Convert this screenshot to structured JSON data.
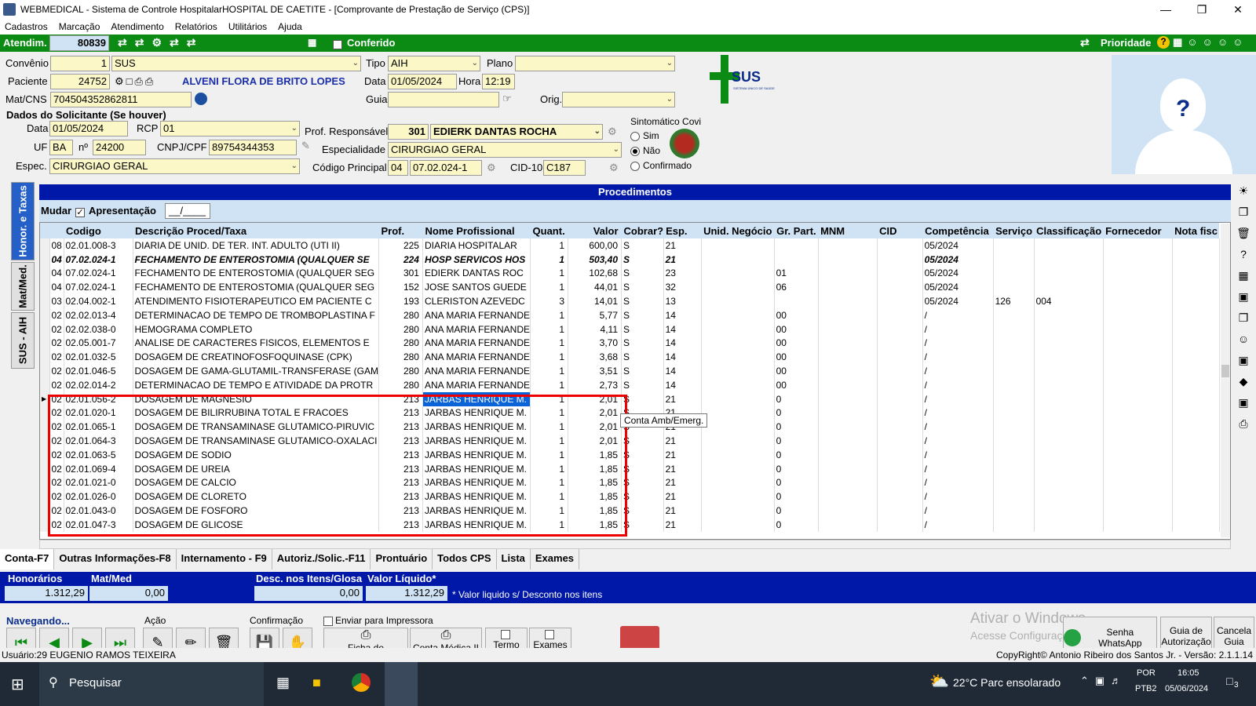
{
  "window": {
    "title": "WEBMEDICAL - Sistema de Controle HospitalarHOSPITAL DE CAETITE - [Comprovante de Prestação de Serviço  (CPS)]"
  },
  "menu": [
    "Cadastros",
    "Marcação",
    "Atendimento",
    "Relatórios",
    "Utilitários",
    "Ajuda"
  ],
  "topbar": {
    "atendim_label": "Atendim.",
    "atendim_value": "80839",
    "conferido": "Conferido",
    "prioridade": "Prioridade"
  },
  "header": {
    "convenio_label": "Convênio",
    "convenio_code": "1",
    "convenio_name": "SUS",
    "tipo_label": "Tipo",
    "tipo_value": "AIH",
    "plano_label": "Plano",
    "plano_value": "",
    "paciente_label": "Paciente",
    "paciente_code": "24752",
    "paciente_name": "ALVENI FLORA DE BRITO LOPES",
    "data_label": "Data",
    "data_value": "01/05/2024",
    "hora_label": "Hora",
    "hora_value": "12:19",
    "matcns_label": "Mat/CNS",
    "matcns_value": "704504352862811",
    "guia_label": "Guia",
    "guia_value": "",
    "orig_label": "Orig.",
    "orig_value": ""
  },
  "solicitante": {
    "title": "Dados do Solicitante (Se houver)",
    "data_label": "Data",
    "data_value": "01/05/2024",
    "rcp_label": "RCP",
    "rcp_value": "01",
    "uf_label": "UF",
    "uf_value": "BA",
    "n_label": "nº",
    "n_value": "24200",
    "cnpj_label": "CNPJ/CPF",
    "cnpj_value": "89754344353",
    "espec_label": "Espec.",
    "espec_value": "CIRURGIAO GERAL"
  },
  "prof": {
    "resp_label": "Prof. Responsável",
    "resp_code": "301",
    "resp_name": "EDIERK DANTAS ROCHA",
    "espec_label": "Especialidade",
    "espec_value": "CIRURGIAO GERAL",
    "cod_label": "Código Principal",
    "cod_a": "04",
    "cod_b": "07.02.024-1",
    "cid_label": "CID-10",
    "cid_value": "C187"
  },
  "covid": {
    "title": "Sintomático Covi",
    "options": [
      "Sim",
      "Não",
      "Confirmado"
    ],
    "selected": 1
  },
  "sus_logo": {
    "text": "SUS",
    "sub": "SISTEMA ÚNICO DE SAÚDE"
  },
  "side_tabs": [
    "Honor. e Taxas",
    "Mat/Med.",
    "SUS - AIH"
  ],
  "procedures": {
    "title": "Procedimentos",
    "mudar": "Mudar",
    "apresentacao": "Apresentação",
    "apres_value": "__/____",
    "columns": [
      "Codigo",
      "Descrição Proced/Taxa",
      "Prof.",
      "Nome Profissional",
      "Quant.",
      "Valor",
      "Cobrar?",
      "Esp.",
      "Unid. Negócio",
      "Gr. Part.",
      "MNM",
      "CID",
      "Competência",
      "Serviço",
      "Classificação",
      "Fornecedor",
      "Nota fisc"
    ],
    "rows": [
      [
        "08",
        "02.01.008-3",
        "DIARIA DE UNID. DE TER. INT. ADULTO (UTI II)",
        "225",
        "DIARIA HOSPITALAR",
        "1",
        "600,00",
        "S",
        "21",
        "",
        "",
        "",
        "",
        "05/2024",
        "",
        "",
        "",
        ""
      ],
      [
        "04",
        "07.02.024-1",
        "FECHAMENTO DE ENTEROSTOMIA (QUALQUER SE",
        "224",
        "HOSP SERVICOS HOS",
        "1",
        "503,40",
        "S",
        "21",
        "",
        "",
        "",
        "",
        "05/2024",
        "",
        "",
        "",
        ""
      ],
      [
        "04",
        "07.02.024-1",
        "FECHAMENTO DE ENTEROSTOMIA (QUALQUER SEG",
        "301",
        "EDIERK DANTAS ROC",
        "1",
        "102,68",
        "S",
        "23",
        "",
        "01",
        "",
        "",
        "05/2024",
        "",
        "",
        "",
        ""
      ],
      [
        "04",
        "07.02.024-1",
        "FECHAMENTO DE ENTEROSTOMIA (QUALQUER SEG",
        "152",
        "JOSE SANTOS GUEDE",
        "1",
        "44,01",
        "S",
        "32",
        "",
        "06",
        "",
        "",
        "05/2024",
        "",
        "",
        "",
        ""
      ],
      [
        "03",
        "02.04.002-1",
        "ATENDIMENTO FISIOTERAPEUTICO EM PACIENTE C",
        "193",
        "CLERISTON AZEVEDC",
        "3",
        "14,01",
        "S",
        "13",
        "",
        "",
        "",
        "",
        "05/2024",
        "126",
        "004",
        "",
        ""
      ],
      [
        "02",
        "02.02.013-4",
        "DETERMINACAO DE TEMPO DE TROMBOPLASTINA F",
        "280",
        "ANA MARIA FERNANDE",
        "1",
        "5,77",
        "S",
        "14",
        "",
        "00",
        "",
        "",
        "/",
        "",
        "",
        "",
        ""
      ],
      [
        "02",
        "02.02.038-0",
        "HEMOGRAMA COMPLETO",
        "280",
        "ANA MARIA FERNANDE",
        "1",
        "4,11",
        "S",
        "14",
        "",
        "00",
        "",
        "",
        "/",
        "",
        "",
        "",
        ""
      ],
      [
        "02",
        "02.05.001-7",
        "ANALISE DE CARACTERES FISICOS, ELEMENTOS E",
        "280",
        "ANA MARIA FERNANDE",
        "1",
        "3,70",
        "S",
        "14",
        "",
        "00",
        "",
        "",
        "/",
        "",
        "",
        "",
        ""
      ],
      [
        "02",
        "02.01.032-5",
        "DOSAGEM DE CREATINOFOSFOQUINASE (CPK)",
        "280",
        "ANA MARIA FERNANDE",
        "1",
        "3,68",
        "S",
        "14",
        "",
        "00",
        "",
        "",
        "/",
        "",
        "",
        "",
        ""
      ],
      [
        "02",
        "02.01.046-5",
        "DOSAGEM DE GAMA-GLUTAMIL-TRANSFERASE (GAM",
        "280",
        "ANA MARIA FERNANDE",
        "1",
        "3,51",
        "S",
        "14",
        "",
        "00",
        "",
        "",
        "/",
        "",
        "",
        "",
        ""
      ],
      [
        "02",
        "02.02.014-2",
        "DETERMINACAO DE TEMPO E ATIVIDADE DA PROTR",
        "280",
        "ANA MARIA FERNANDE",
        "1",
        "2,73",
        "S",
        "14",
        "",
        "00",
        "",
        "",
        "/",
        "",
        "",
        "",
        ""
      ],
      [
        "02",
        "02.01.056-2",
        "DOSAGEM DE MAGNESIO",
        "213",
        "JARBAS HENRIQUE M.",
        "1",
        "2,01",
        "S",
        "21",
        "",
        "0",
        "",
        "",
        "/",
        "",
        "",
        "",
        ""
      ],
      [
        "02",
        "02.01.020-1",
        "DOSAGEM DE BILIRRUBINA TOTAL E FRACOES",
        "213",
        "JARBAS HENRIQUE M.",
        "1",
        "2,01",
        "S",
        "21",
        "",
        "0",
        "",
        "",
        "/",
        "",
        "",
        "",
        ""
      ],
      [
        "02",
        "02.01.065-1",
        "DOSAGEM DE TRANSAMINASE GLUTAMICO-PIRUVIC",
        "213",
        "JARBAS HENRIQUE M.",
        "1",
        "2,01",
        "S",
        "21",
        "",
        "0",
        "",
        "",
        "/",
        "",
        "",
        "",
        ""
      ],
      [
        "02",
        "02.01.064-3",
        "DOSAGEM DE TRANSAMINASE GLUTAMICO-OXALACI",
        "213",
        "JARBAS HENRIQUE M.",
        "1",
        "2,01",
        "S",
        "21",
        "",
        "0",
        "",
        "",
        "/",
        "",
        "",
        "",
        ""
      ],
      [
        "02",
        "02.01.063-5",
        "DOSAGEM DE SODIO",
        "213",
        "JARBAS HENRIQUE M.",
        "1",
        "1,85",
        "S",
        "21",
        "",
        "0",
        "",
        "",
        "/",
        "",
        "",
        "",
        ""
      ],
      [
        "02",
        "02.01.069-4",
        "DOSAGEM DE UREIA",
        "213",
        "JARBAS HENRIQUE M.",
        "1",
        "1,85",
        "S",
        "21",
        "",
        "0",
        "",
        "",
        "/",
        "",
        "",
        "",
        ""
      ],
      [
        "02",
        "02.01.021-0",
        "DOSAGEM DE CALCIO",
        "213",
        "JARBAS HENRIQUE M.",
        "1",
        "1,85",
        "S",
        "21",
        "",
        "0",
        "",
        "",
        "/",
        "",
        "",
        "",
        ""
      ],
      [
        "02",
        "02.01.026-0",
        "DOSAGEM DE CLORETO",
        "213",
        "JARBAS HENRIQUE M.",
        "1",
        "1,85",
        "S",
        "21",
        "",
        "0",
        "",
        "",
        "/",
        "",
        "",
        "",
        ""
      ],
      [
        "02",
        "02.01.043-0",
        "DOSAGEM DE FOSFORO",
        "213",
        "JARBAS HENRIQUE M.",
        "1",
        "1,85",
        "S",
        "21",
        "",
        "0",
        "",
        "",
        "/",
        "",
        "",
        "",
        ""
      ],
      [
        "02",
        "02.01.047-3",
        "DOSAGEM DE GLICOSE",
        "213",
        "JARBAS HENRIQUE M.",
        "1",
        "1,85",
        "S",
        "21",
        "",
        "0",
        "",
        "",
        "/",
        "",
        "",
        "",
        ""
      ]
    ],
    "tooltip": "Conta Amb/Emerg."
  },
  "bottom_tabs": [
    "Conta-F7",
    "Outras Informações-F8",
    "Internamento - F9",
    "Autoriz./Solic.-F11",
    "Prontuário",
    "Todos CPS",
    "Lista",
    "Exames"
  ],
  "totals": {
    "honorarios_label": "Honorários",
    "honorarios_value": "1.312,29",
    "matmed_label": "Mat/Med",
    "matmed_value": "0,00",
    "desc_label": "Desc. nos Itens/Glosa",
    "desc_value": "0,00",
    "liquido_label": "Valor Líquido*",
    "liquido_value": "1.312,29",
    "note": "* Valor liquido s/ Desconto nos itens"
  },
  "actions": {
    "navegando": "Navegando...",
    "acao": "Ação",
    "confirmacao": "Confirmação",
    "enviar": "Enviar para Impressora",
    "ficha": "Ficha de Atendimento",
    "conta_medica": "Conta Médica II",
    "termo": "Termo",
    "exames": "Exames",
    "whatsapp": "Senha WhatsApp",
    "guia_aut": "Guia de Autorização",
    "cancela": "Cancela Guia"
  },
  "watermark": {
    "line1": "Ativar o Windows",
    "line2": "Acesse Configurações"
  },
  "status": {
    "user": "Usuário:29 EUGENIO RAMOS TEIXEIRA",
    "copyright": "CopyRight© Antonio Ribeiro dos Santos Jr. - Versão: 2.1.1.14"
  },
  "taskbar": {
    "search": "Pesquisar",
    "weather": "22°C  Parc ensolarado",
    "lang": "POR",
    "lang2": "PTB2",
    "time": "16:05",
    "date": "05/06/2024",
    "notif": "3"
  }
}
